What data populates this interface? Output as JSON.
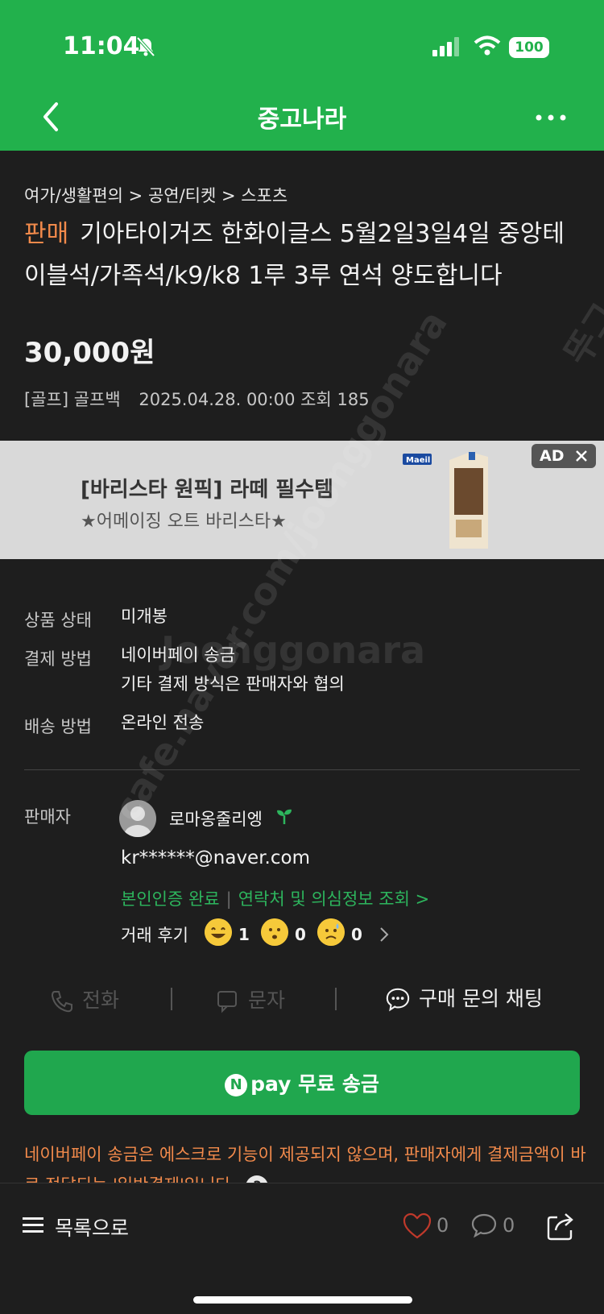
{
  "status_bar": {
    "time": "11:04",
    "battery": "100"
  },
  "nav": {
    "title": "중고나라"
  },
  "post": {
    "breadcrumb": "여가/생활편의 > 공연/티켓 > 스포츠",
    "sale_tag": "판매",
    "title": "기아타이거즈 한화이글스 5월2일3일4일 중앙테이블석/가족석/k9/k8 1루 3루 연석 양도합니다",
    "price": "30,000원",
    "category": "[골프] 골프백",
    "date": "2025.04.28. 00:00",
    "views": "조회 185"
  },
  "ad": {
    "title": "[바리스타 원픽] 라떼 필수템",
    "subtitle": "★어메이징 오트 바리스타★",
    "badge": "AD"
  },
  "details": [
    {
      "label": "상품 상태",
      "value": "미개봉"
    },
    {
      "label": "결제 방법",
      "value": "네이버페이 송금",
      "value2": "기타 결제 방식은 판매자와 협의"
    },
    {
      "label": "배송 방법",
      "value": "온라인 전송"
    }
  ],
  "seller": {
    "label": "판매자",
    "name": "로마옹줄리엥",
    "email": "kr******@naver.com",
    "verified": "본인인증 완료",
    "lookup": "연락처 및 의심정보 조회 >",
    "review_label": "거래 후기",
    "reviews": [
      {
        "icon": "grin-emoji-icon",
        "count": "1"
      },
      {
        "icon": "neutral-emoji-icon",
        "count": "0"
      },
      {
        "icon": "sad-emoji-icon",
        "count": "0"
      }
    ]
  },
  "contact": {
    "phone": "전화",
    "sms": "문자",
    "chat": "구매 문의 채팅"
  },
  "pay_button": {
    "n": "N",
    "label": "pay 무료 송금"
  },
  "warning": "네이버페이 송금은 에스크로 기능이 제공되지 않으며, 판매자에게 결제금액이 바로 전달되는 '일반결제'입니다.",
  "help_q": "?",
  "bottom": {
    "list": "목록으로",
    "likes": "0",
    "comments": "0"
  },
  "watermark": {
    "vertical": "cafe.naver.com/joonggonara",
    "logo": "Joonggonara",
    "side": "뚜그"
  },
  "colors": {
    "brand_green": "#22b14c",
    "accent_orange": "#f28a4b",
    "background": "#1e1e1e"
  }
}
